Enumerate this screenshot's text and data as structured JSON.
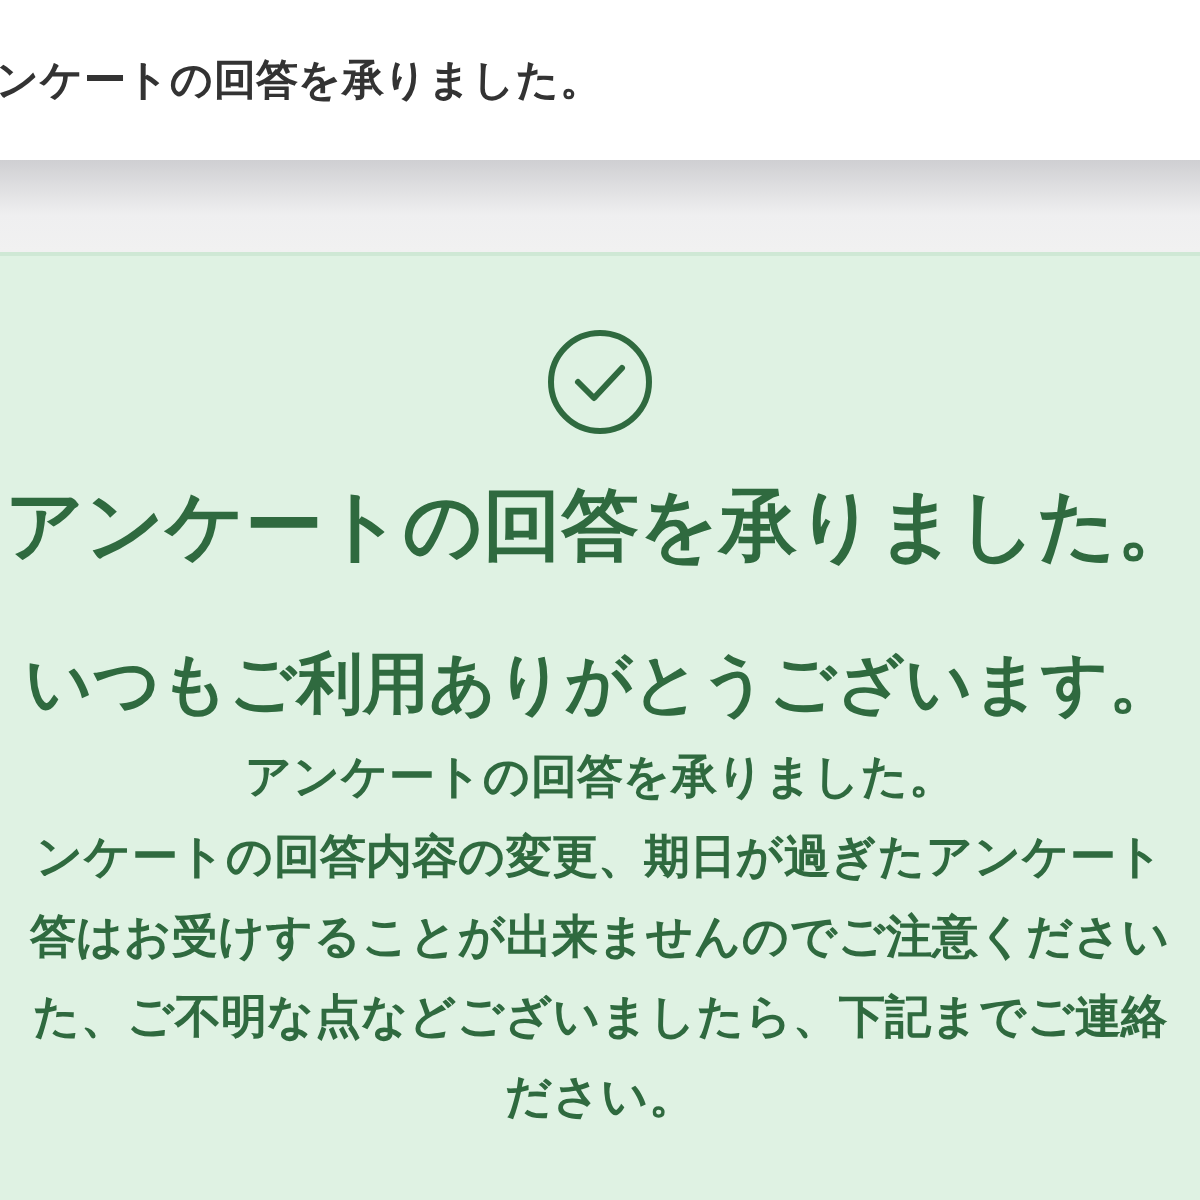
{
  "header": {
    "title": "ンケートの回答を承りました。"
  },
  "message": {
    "heading": "アンケートの回答を承りました。",
    "subheading": "いつもご利用ありがとうございます。",
    "lines": [
      "アンケートの回答を承りました。",
      "ンケートの回答内容の変更、期日が過ぎたアンケート",
      "答はお受けすることが出来ませんのでご注意ください",
      "た、ご不明な点などございましたら、下記までご連絡",
      "ださい。"
    ]
  }
}
